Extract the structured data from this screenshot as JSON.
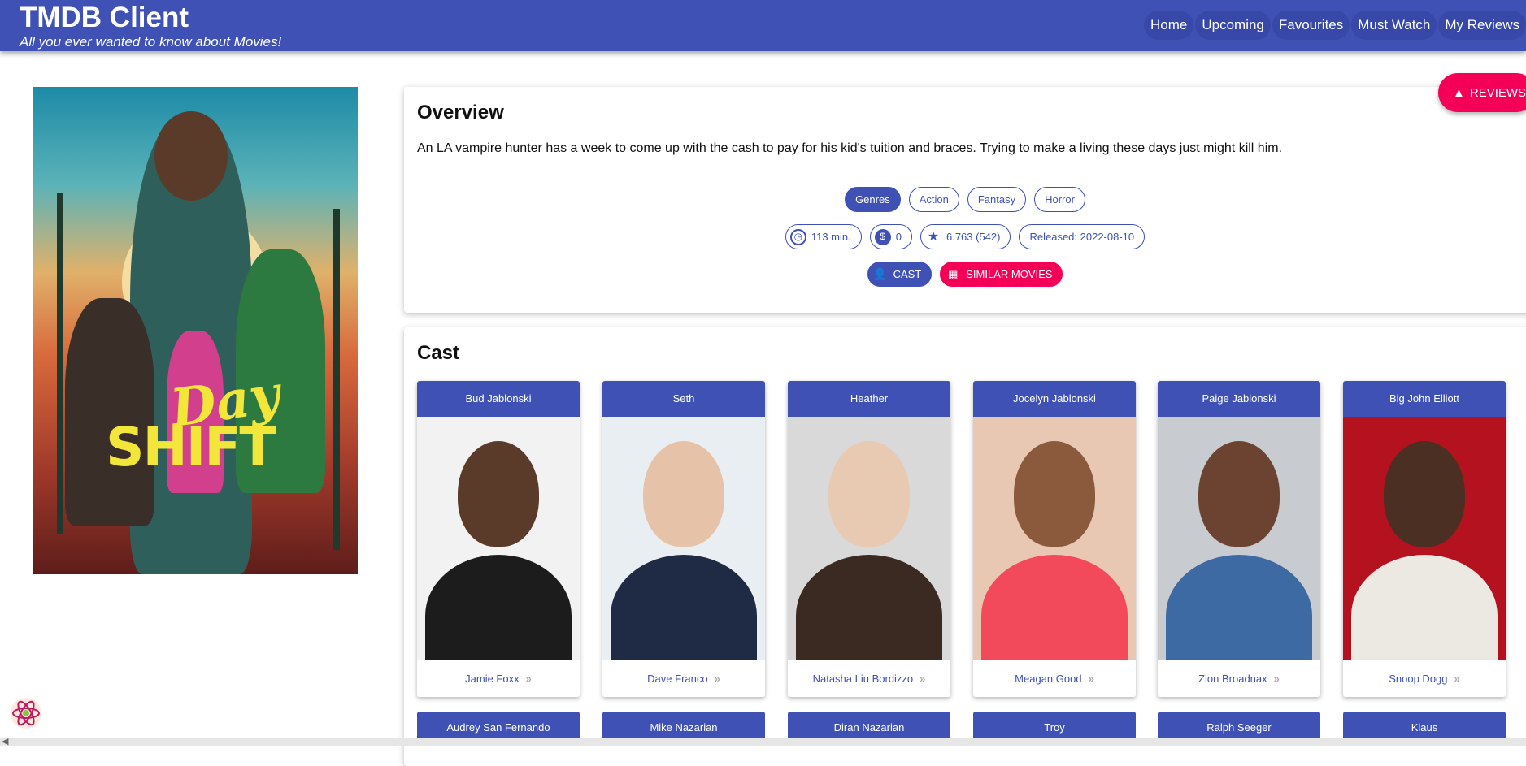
{
  "header": {
    "brand": "TMDB Client",
    "tagline": "All you ever wanted to know about Movies!",
    "nav": [
      "Home",
      "Upcoming",
      "Favourites",
      "Must Watch",
      "My Reviews"
    ]
  },
  "poster": {
    "line1": "Day",
    "line2": "SHIFT"
  },
  "reviews_fab": {
    "label": "REVIEWS",
    "icon": "navigation-icon"
  },
  "overview": {
    "title": "Overview",
    "text": "An LA vampire hunter has a week to come up with the cash to pay for his kid's tuition and braces. Trying to make a living these days just might kill him.",
    "genres_label": "Genres",
    "genres": [
      "Action",
      "Fantasy",
      "Horror"
    ],
    "runtime": "113 min.",
    "revenue": "0",
    "rating": "6.763 (542)",
    "released": "Released: 2022-08-10",
    "cast_button": "CAST",
    "similar_button": "SIMILAR MOVIES"
  },
  "cast": {
    "title": "Cast",
    "members": [
      {
        "role": "Bud Jablonski",
        "actor": "Jamie Foxx",
        "bg": "#f2f2f2",
        "skin": "#5a3b2a",
        "cloth": "#1c1c1c"
      },
      {
        "role": "Seth",
        "actor": "Dave Franco",
        "bg": "#e9eef2",
        "skin": "#e6c3a8",
        "cloth": "#1f2b45"
      },
      {
        "role": "Heather",
        "actor": "Natasha Liu Bordizzo",
        "bg": "#d9d9d9",
        "skin": "#e8c9b1",
        "cloth": "#3b2a22"
      },
      {
        "role": "Jocelyn Jablonski",
        "actor": "Meagan Good",
        "bg": "#e8c7b3",
        "skin": "#8b5a3c",
        "cloth": "#f24a5a"
      },
      {
        "role": "Paige Jablonski",
        "actor": "Zion Broadnax",
        "bg": "#c8ccd0",
        "skin": "#6b4330",
        "cloth": "#3e6aa3"
      },
      {
        "role": "Big John Elliott",
        "actor": "Snoop Dogg",
        "bg": "#b3121e",
        "skin": "#4a2f22",
        "cloth": "#ece8e2"
      }
    ],
    "next_row": [
      "Audrey San Fernando",
      "Mike Nazarian",
      "Diran Nazarian",
      "Troy",
      "Ralph Seeger",
      "Klaus"
    ]
  },
  "colors": {
    "primary": "#3f51b5",
    "secondary": "#f50057"
  }
}
